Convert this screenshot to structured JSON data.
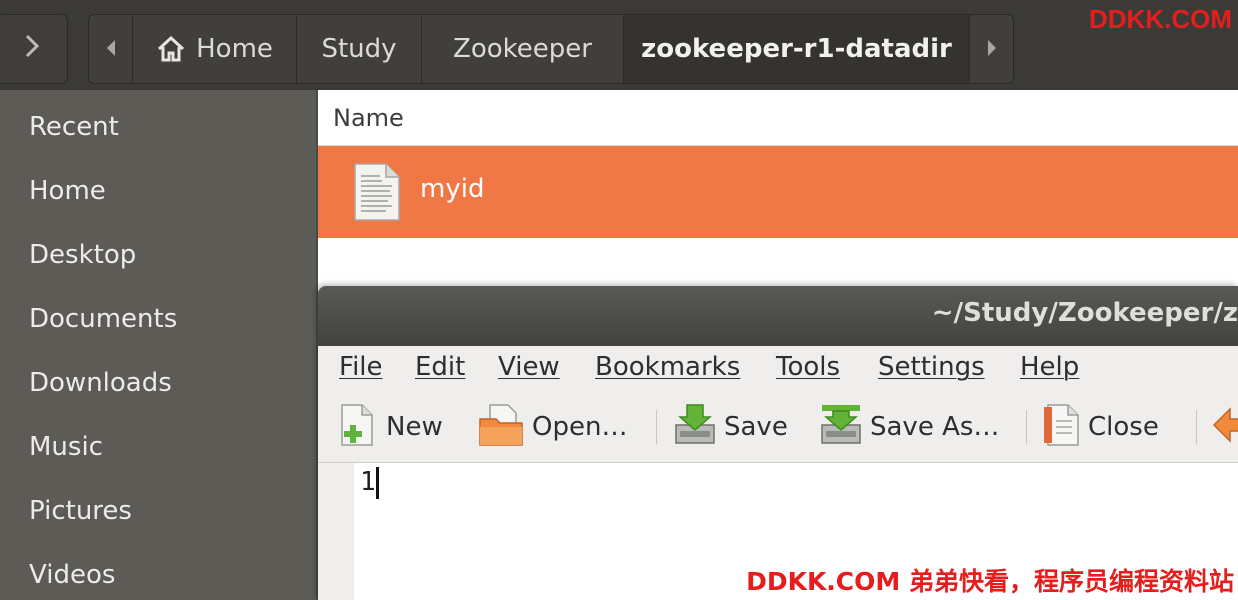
{
  "pathbar": {
    "crumbs": [
      "Home",
      "Study",
      "Zookeeper",
      "zookeeper-r1-datadir"
    ]
  },
  "sidebar": {
    "items": [
      "Recent",
      "Home",
      "Desktop",
      "Documents",
      "Downloads",
      "Music",
      "Pictures",
      "Videos"
    ]
  },
  "filelist": {
    "column_header": "Name",
    "files": [
      {
        "name": "myid",
        "icon": "text-file-icon",
        "selected": true
      }
    ],
    "selection_color": "#f07746"
  },
  "editor": {
    "title": "~/Study/Zookeeper/z",
    "menu": [
      "File",
      "Edit",
      "View",
      "Bookmarks",
      "Tools",
      "Settings",
      "Help"
    ],
    "toolbar": {
      "new_label": "New",
      "open_label": "Open…",
      "save_label": "Save",
      "save_as_label": "Save As…",
      "close_label": "Close"
    },
    "content": "1"
  },
  "watermarks": {
    "top": "DDKK.COM",
    "bottom": "DDKK.COM 弟弟快看，程序员编程资料站"
  }
}
